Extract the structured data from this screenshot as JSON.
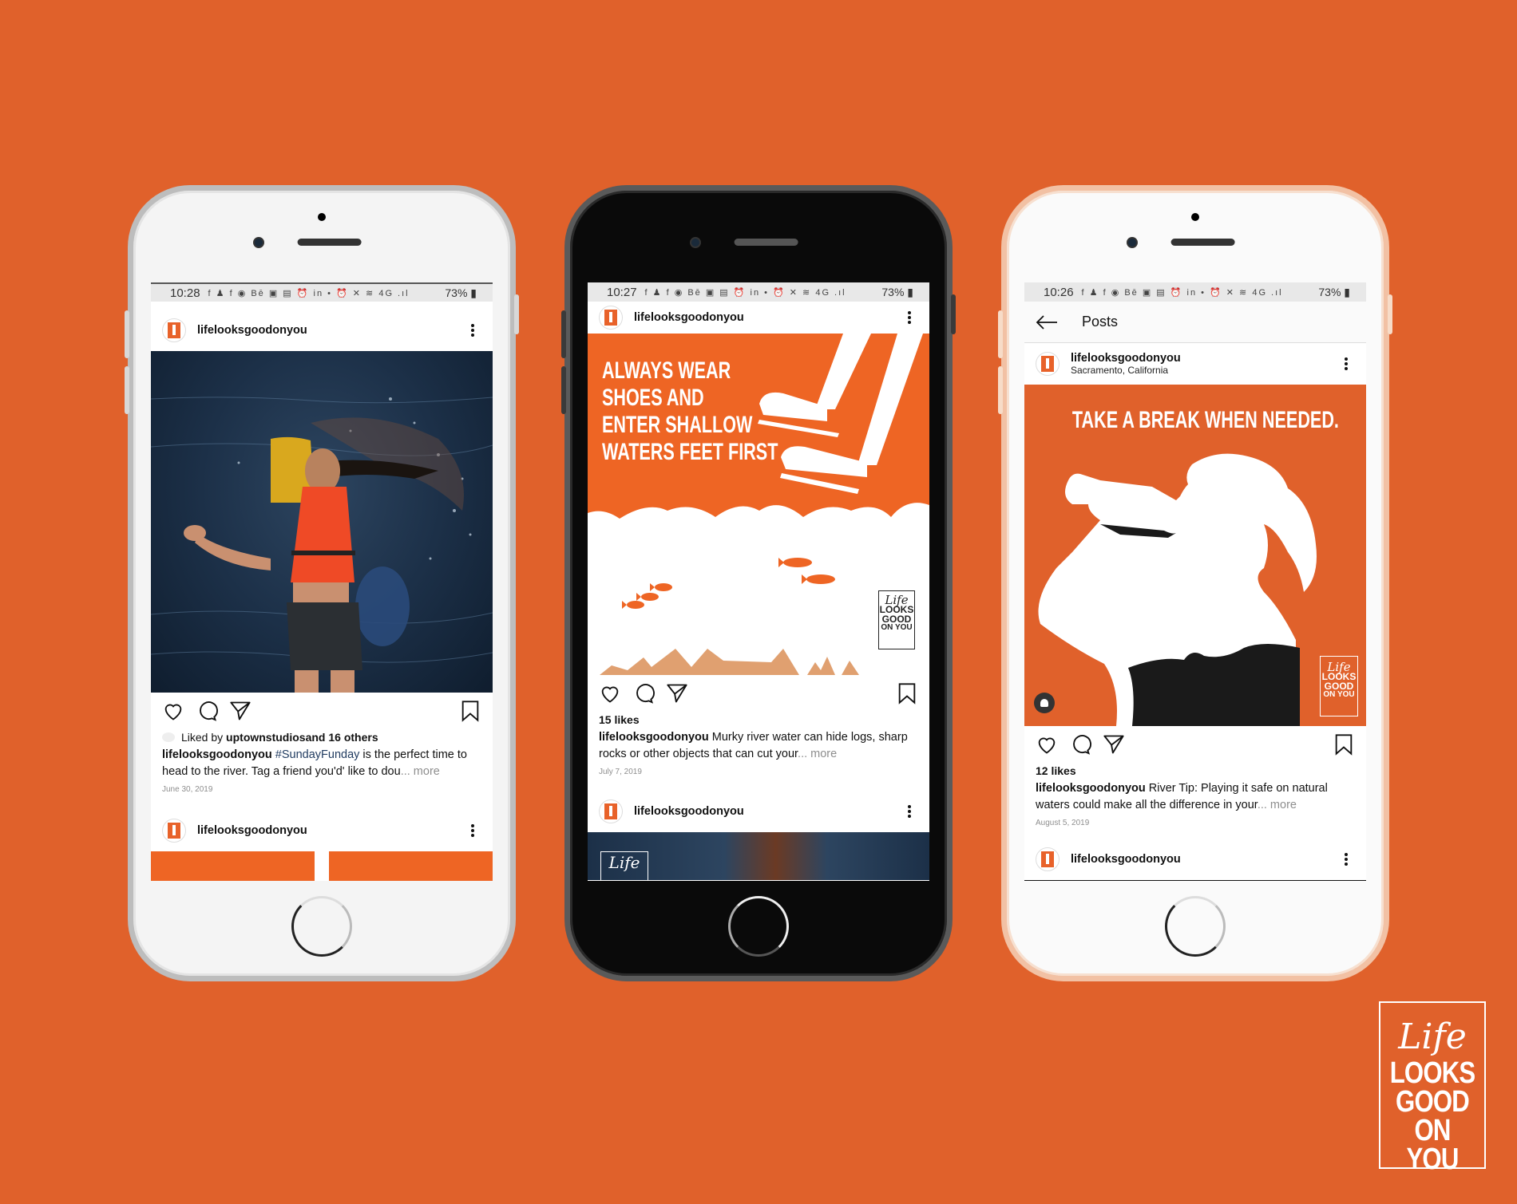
{
  "background_color": "#e0612b",
  "brand_color": "#ee6524",
  "corner_logo": {
    "script": "Life",
    "line1": "LOOKS",
    "line2": "GOOD",
    "line3": "ON YOU"
  },
  "status_icons": "f ♟ f ◉ Bē ▣ ▤ ⏰ in • ⏰ ✕ ≋ 4G .ıl",
  "phones": [
    {
      "frame": "white",
      "status": {
        "time": "10:28",
        "battery": "73%"
      },
      "post1": {
        "username": "lifelooksgoodonyou",
        "image_alt": "Woman in orange life vest splashing in river",
        "liked_by_prefix": "Liked by ",
        "liked_by_user": "uptownstudios",
        "liked_by_suffix": " and 16 others",
        "caption_user": "lifelooksgoodonyou",
        "caption_hashtag": "#SundayFunday",
        "caption_text": " is the perfect time to head to the river. Tag a friend you'd' like to dou",
        "caption_more": "... more",
        "date": "June 30, 2019"
      },
      "post2": {
        "username": "lifelooksgoodonyou"
      }
    },
    {
      "frame": "black",
      "status": {
        "time": "10:27",
        "battery": "73%"
      },
      "post1": {
        "username": "lifelooksgoodonyou",
        "poster_lines": [
          "ALWAYS WEAR",
          "SHOES AND",
          "ENTER SHALLOW",
          "WATERS FEET FIRST"
        ],
        "logo": {
          "script": "Life",
          "line1": "LOOKS",
          "line2": "GOOD",
          "line3": "ON YOU"
        },
        "likes": "15 likes",
        "caption_user": "lifelooksgoodonyou",
        "caption_text": " Murky river water can hide logs, sharp rocks or other objects that can cut your",
        "caption_more": "... more",
        "date": "July 7, 2019"
      },
      "post2": {
        "username": "lifelooksgoodonyou",
        "logo_script": "Life"
      }
    },
    {
      "frame": "rose-gold",
      "status": {
        "time": "10:26",
        "battery": "73%"
      },
      "nav": {
        "title": "Posts"
      },
      "post1": {
        "username": "lifelooksgoodonyou",
        "location": "Sacramento, California",
        "poster_title": "TAKE A BREAK WHEN NEEDED.",
        "logo": {
          "script": "Life",
          "line1": "LOOKS",
          "line2": "GOOD",
          "line3": "ON YOU"
        },
        "likes": "12 likes",
        "caption_user": "lifelooksgoodonyou",
        "caption_text": " River Tip: Playing it safe on natural waters could make all the difference in your",
        "caption_more": "... more",
        "date": "August 5, 2019"
      },
      "post2": {
        "username": "lifelooksgoodonyou"
      }
    }
  ]
}
